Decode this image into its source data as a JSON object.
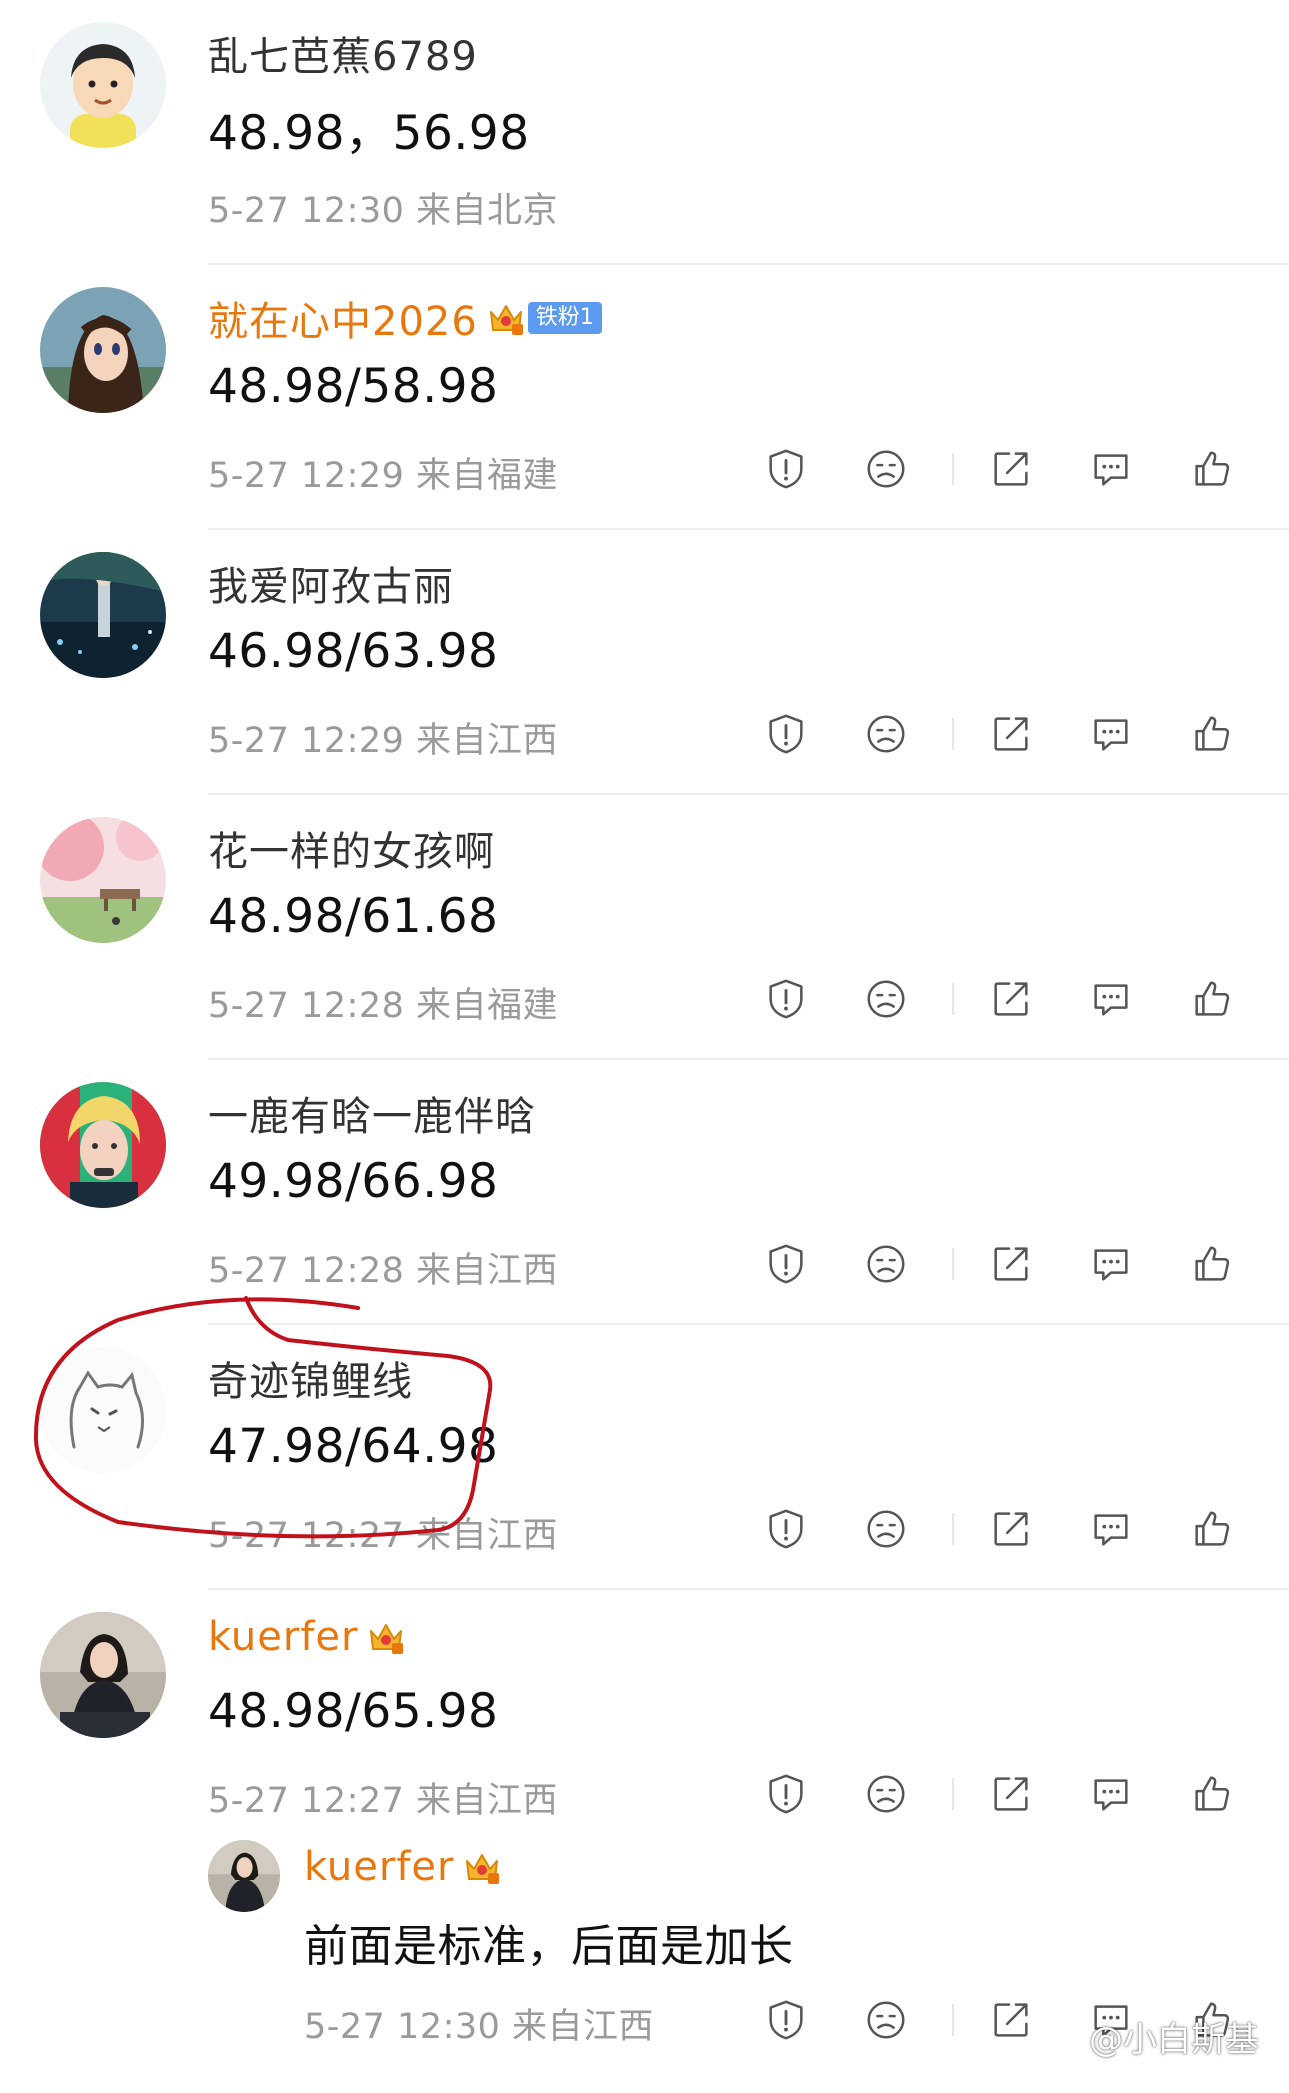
{
  "comments": [
    {
      "username": "乱七芭蕉6789",
      "text": "48.98，56.98",
      "meta": "5-27 12:30  来自北京"
    },
    {
      "username": "就在心中2026",
      "badge": "铁粉1",
      "text": "48.98/58.98",
      "meta": "5-27 12:29  来自福建"
    },
    {
      "username": "我爱阿孜古丽",
      "text": "46.98/63.98",
      "meta": "5-27 12:29  来自江西"
    },
    {
      "username": "花一样的女孩啊",
      "text": "48.98/61.68",
      "meta": "5-27 12:28  来自福建"
    },
    {
      "username": "一鹿有晗一鹿伴晗",
      "text": "49.98/66.98",
      "meta": "5-27 12:28  来自江西"
    },
    {
      "username": "奇迹锦鲤线",
      "text": "47.98/64.98",
      "meta": "5-27 12:27  来自江西"
    },
    {
      "username": "kuerfer",
      "text": "48.98/65.98",
      "meta": "5-27 12:27  来自江西"
    }
  ],
  "reply": {
    "username": "kuerfer",
    "text": "前面是标准，后面是加长",
    "meta": "5-27 12:30  来自江西"
  },
  "watermark": "@小白斯基",
  "icons": [
    "report-icon",
    "dislike-icon",
    "share-icon",
    "comment-icon",
    "like-icon"
  ],
  "colors": {
    "vip_name": "#e8780e",
    "highlight_circle": "#c0121c",
    "badge": "#5d9bf0"
  }
}
